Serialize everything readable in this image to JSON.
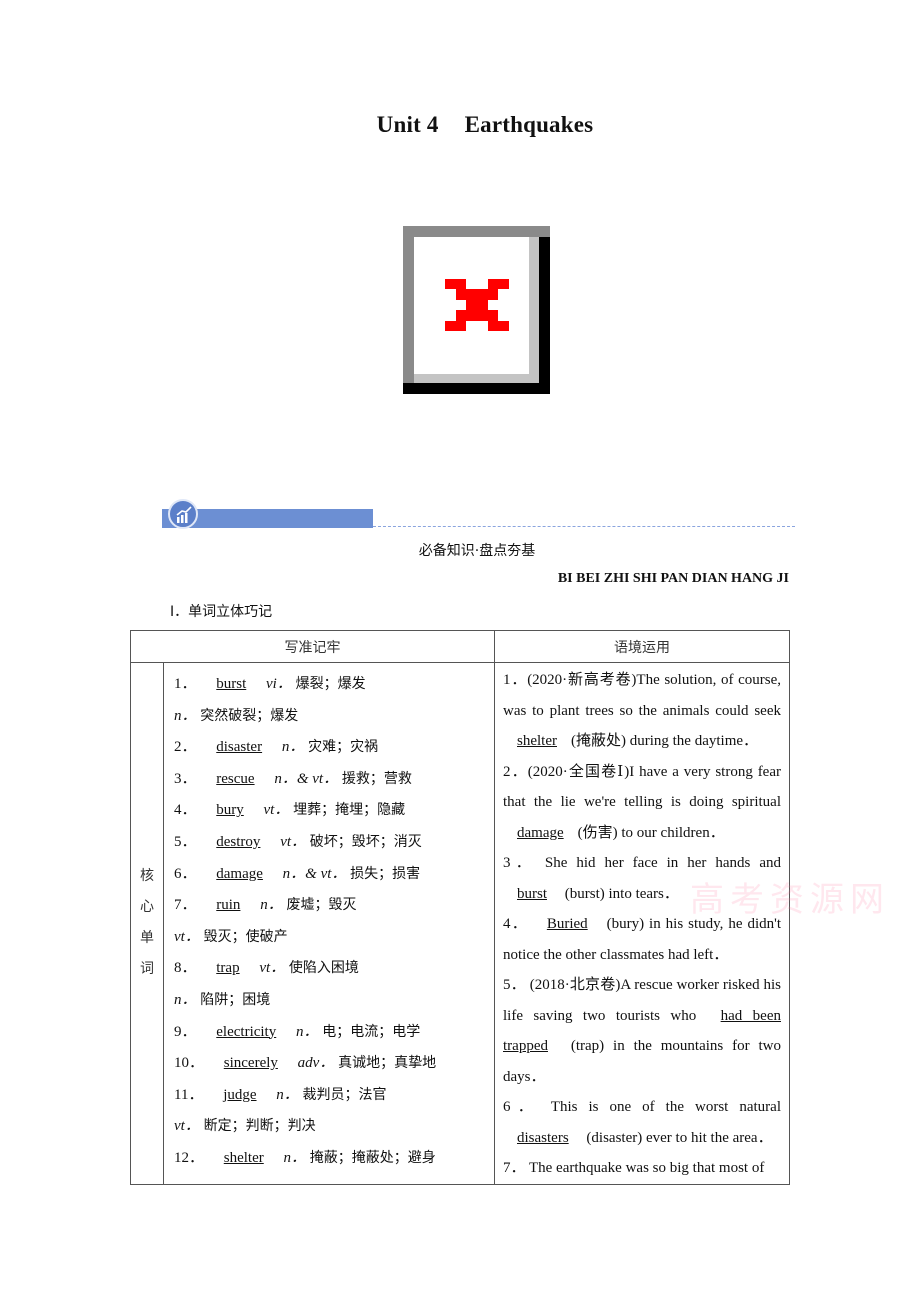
{
  "document": {
    "title_unit": "Unit 4",
    "title_topic": "Earthquakes",
    "image_placeholder": "broken-image-icon",
    "section_banner_icon": "chart-growth-icon",
    "section_title_cn": "必备知识·盘点夯基",
    "section_title_pinyin": "BI BEI ZHI SHI PAN DIAN HANG JI",
    "sub_heading": "Ⅰ．单词立体巧记",
    "watermark": "高考资源网"
  },
  "table": {
    "headers": [
      "写准记牢",
      "语境运用"
    ],
    "category": [
      "核",
      "心",
      "单",
      "词"
    ],
    "vocab": [
      {
        "num": "1．",
        "word": "burst",
        "pos": "vi．",
        "meaning": "爆裂；爆发"
      },
      {
        "num": "",
        "word": "",
        "pos": "n．",
        "meaning": "突然破裂；爆发"
      },
      {
        "num": "2．",
        "word": "disaster",
        "pos": "n．",
        "meaning": "灾难；灾祸"
      },
      {
        "num": "3．",
        "word": "rescue",
        "pos": "n．& vt．",
        "meaning": "援救；营救"
      },
      {
        "num": "4．",
        "word": "bury",
        "pos": "vt．",
        "meaning": "埋葬；掩埋；隐藏"
      },
      {
        "num": "5．",
        "word": "destroy",
        "pos": "vt．",
        "meaning": "破坏；毁坏；消灭"
      },
      {
        "num": "6．",
        "word": "damage",
        "pos": "n．& vt．",
        "meaning": "损失；损害"
      },
      {
        "num": "7．",
        "word": "ruin",
        "pos": "n．",
        "meaning": "废墟；毁灭"
      },
      {
        "num": "",
        "word": "",
        "pos": "vt．",
        "meaning": "毁灭；使破产"
      },
      {
        "num": "8．",
        "word": "trap",
        "pos": "vt．",
        "meaning": "使陷入困境"
      },
      {
        "num": "",
        "word": "",
        "pos": "n．",
        "meaning": "陷阱；困境"
      },
      {
        "num": "9．",
        "word": "electricity",
        "pos": "n．",
        "meaning": "电；电流；电学"
      },
      {
        "num": "10．",
        "word": "sincerely",
        "pos": "adv．",
        "meaning": "真诚地；真挚地"
      },
      {
        "num": "11．",
        "word": "judge",
        "pos": "n．",
        "meaning": "裁判员；法官"
      },
      {
        "num": "",
        "word": "",
        "pos": "vt．",
        "meaning": "断定；判断；判决"
      },
      {
        "num": "12．",
        "word": "shelter",
        "pos": "n．",
        "meaning": "掩蔽；掩蔽处；避身"
      }
    ],
    "exercises": [
      {
        "pre": "1．(2020·新高考卷)The solution, of course, was to plant trees so the animals could seek ",
        "answer": "shelter",
        "post": "(掩蔽处) during the daytime．"
      },
      {
        "pre": "2．(2020·全国卷Ⅰ)I have a very strong fear that the lie we're telling is doing spiritual ",
        "answer": "damage",
        "post": "(伤害) to our children．"
      },
      {
        "pre": "3． She hid her face in her hands and ",
        "answer": "burst",
        "post": " (burst) into tears．"
      },
      {
        "pre": "4． ",
        "answer": "Buried",
        "post": " (bury) in his study, he didn't notice the other classmates had left．"
      },
      {
        "pre": "5． (2018·北京卷)A rescue worker risked his life saving two tourists who ",
        "answer": "had been trapped",
        "post": " (trap) in the mountains for two days．"
      },
      {
        "pre": "6． This is one of the worst natural ",
        "answer": "disasters",
        "post": " (disaster) ever to hit the area．"
      },
      {
        "pre": "7． The earthquake was so big that most of",
        "answer": "",
        "post": ""
      }
    ]
  }
}
